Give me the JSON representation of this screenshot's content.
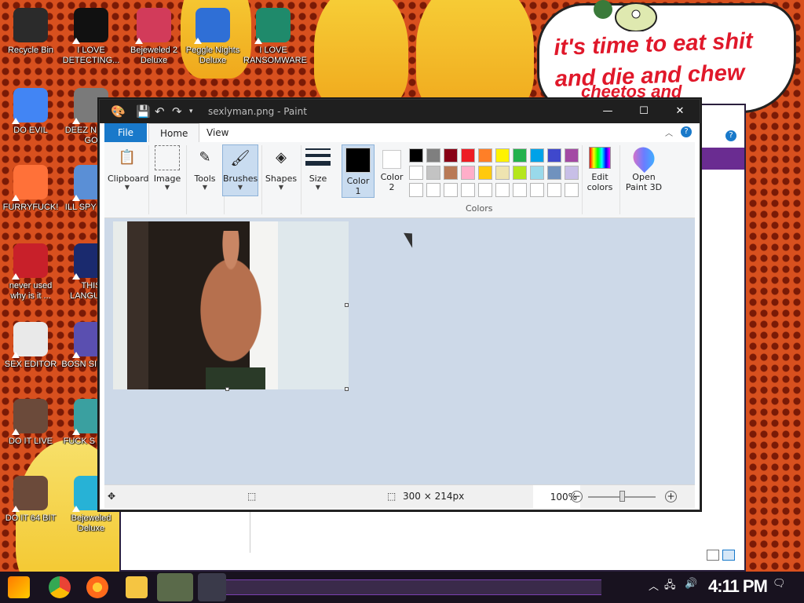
{
  "desktop": {
    "icons": [
      {
        "label": "Recycle Bin",
        "icon": "recycle-bin-icon",
        "color": "#2b2b2b"
      },
      {
        "label": "I LOVE DETECTING...",
        "icon": "detect-it-easy-icon",
        "color": "#111111"
      },
      {
        "label": "Bejeweled 2 Deluxe",
        "icon": "bejeweled-2-icon",
        "color": "#d23b5a"
      },
      {
        "label": "Peggle Nights Deluxe",
        "icon": "peggle-icon",
        "color": "#2f6fd6"
      },
      {
        "label": "I LOVE RANSOMWARE",
        "icon": "publisher-icon",
        "color": "#1f8a6b"
      },
      {
        "label": "DO EVIL",
        "icon": "chrome-icon",
        "color": "#4285f4"
      },
      {
        "label": "DEEZ N HAH GO",
        "icon": "doc-stack-icon",
        "color": "#7a7a7a"
      },
      {
        "label": "FURRYFUCK!",
        "icon": "firefox-icon",
        "color": "#ff7139"
      },
      {
        "label": "ILL SPY YOU",
        "icon": "spy-icon",
        "color": "#5a8fd6"
      },
      {
        "label": "never used why is it ...",
        "icon": "dev-cpp-icon",
        "color": "#c8202a"
      },
      {
        "label": "THIS LANGUAG",
        "icon": "go-icon",
        "color": "#1a2a6e"
      },
      {
        "label": "SEX EDITOR",
        "icon": "hxd-icon",
        "color": "#e9e9e9"
      },
      {
        "label": "BOSN SIMULA",
        "icon": "bosn-icon",
        "color": "#5a4fb0"
      },
      {
        "label": "DO IT LIVE",
        "icon": "portrait-icon",
        "color": "#6b4a3a"
      },
      {
        "label": "FUCK S ELVE",
        "icon": "game-icon",
        "color": "#3aa0a0"
      },
      {
        "label": "DO IT 64 BIT",
        "icon": "portrait-64-icon",
        "color": "#6b4a3a"
      },
      {
        "label": "Bejeweled Deluxe",
        "icon": "bejeweled-icon",
        "color": "#27b2d6"
      }
    ],
    "speech_bubble": {
      "line1": "it's time to eat shit",
      "line2": "and die and chew",
      "line3": "cheetos and"
    }
  },
  "paint": {
    "title": "sexlyman.png - Paint",
    "tabs": {
      "file": "File",
      "home": "Home",
      "view": "View"
    },
    "groups": {
      "clipboard": "Clipboard",
      "image": "Image",
      "tools": "Tools",
      "brushes": "Brushes",
      "shapes": "Shapes",
      "size": "Size",
      "color1_line1": "Color",
      "color1_line2": "1",
      "color2_line1": "Color",
      "color2_line2": "2",
      "edit_colors_line1": "Edit",
      "edit_colors_line2": "colors",
      "open3d_line1": "Open",
      "open3d_line2": "Paint 3D",
      "colors": "Colors"
    },
    "color1": "#000000",
    "color2": "#ffffff",
    "palette_row1": [
      "#000000",
      "#7f7f7f",
      "#880015",
      "#ed1c24",
      "#ff7f27",
      "#fff200",
      "#22b14c",
      "#00a2e8",
      "#3f48cc",
      "#a349a4"
    ],
    "palette_row2": [
      "#ffffff",
      "#c3c3c3",
      "#b97a57",
      "#ffaec9",
      "#ffc90e",
      "#efe4b0",
      "#b5e61d",
      "#99d9ea",
      "#7092be",
      "#c8bfe7"
    ],
    "palette_row3": [
      "#ffffff",
      "#ffffff",
      "#ffffff",
      "#ffffff",
      "#ffffff",
      "#ffffff",
      "#ffffff",
      "#ffffff",
      "#ffffff",
      "#ffffff"
    ],
    "status": {
      "dimensions": "300 × 214px",
      "zoom": "100%"
    }
  },
  "taskbar": {
    "clock": "4:11 PM"
  }
}
